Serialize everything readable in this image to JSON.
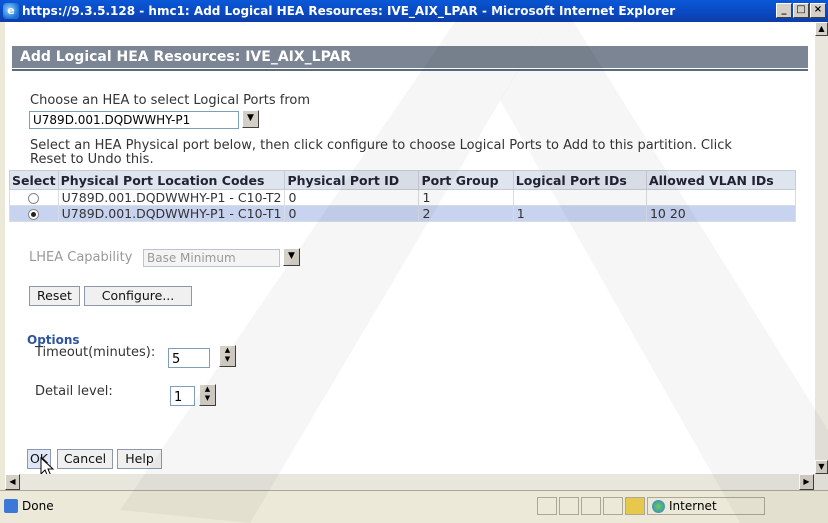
{
  "window": {
    "title": "https://9.3.5.128 - hmc1: Add Logical HEA Resources: IVE_AIX_LPAR - Microsoft Internet Explorer",
    "min_label": "_",
    "max_label": "□",
    "close_label": "×"
  },
  "page": {
    "heading": "Add Logical HEA Resources: IVE_AIX_LPAR",
    "choose_label": "Choose an HEA to select Logical Ports from",
    "hea_selected": "U789D.001.DQDWWHY-P1",
    "instructions_line1": "Select an HEA Physical port below, then click configure to choose Logical Ports to Add to this partition. Click",
    "instructions_line2": "Reset to Undo this."
  },
  "table": {
    "headers": [
      "Select",
      "Physical Port Location Codes",
      "Physical Port ID",
      "Port Group",
      "Logical Port IDs",
      "Allowed VLAN IDs"
    ],
    "rows": [
      {
        "selected": false,
        "location": "U789D.001.DQDWWHY-P1 - C10-T2",
        "port_id": "0",
        "port_group": "1",
        "logical_ids": "",
        "vlan_ids": ""
      },
      {
        "selected": true,
        "location": "U789D.001.DQDWWHY-P1 - C10-T1",
        "port_id": "0",
        "port_group": "2",
        "logical_ids": "1",
        "vlan_ids": "10 20"
      }
    ]
  },
  "lhea": {
    "label": "LHEA Capability",
    "value": "Base Minimum"
  },
  "actions": {
    "reset": "Reset",
    "configure": "Configure..."
  },
  "options": {
    "title": "Options",
    "timeout_label": "Timeout(minutes):",
    "timeout_value": "5",
    "detail_label": "Detail level:",
    "detail_value": "1"
  },
  "footer": {
    "ok": "OK",
    "cancel": "Cancel",
    "help": "Help"
  },
  "status": {
    "text": "Done",
    "zone": "Internet"
  }
}
